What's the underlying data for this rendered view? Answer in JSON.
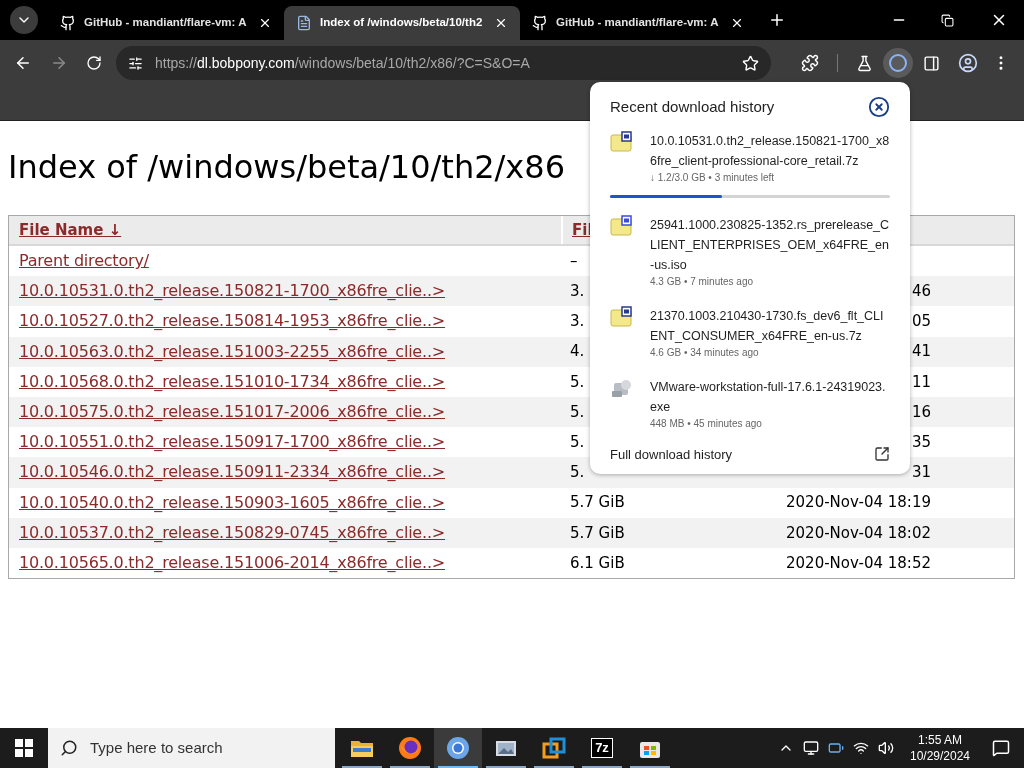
{
  "tabs": [
    {
      "title": "GitHub - mandiant/flare-vm: A",
      "kind": "github",
      "selected": false
    },
    {
      "title": "Index of /windows/beta/10/th2",
      "kind": "page",
      "selected": true
    },
    {
      "title": "GitHub - mandiant/flare-vm: A",
      "kind": "github",
      "selected": false
    }
  ],
  "address": {
    "scheme": "https://",
    "host": "dl.bobpony.com",
    "path": "/windows/beta/10/th2/x86/?C=S&O=A"
  },
  "page": {
    "heading": "Index of /windows/beta/10/th2/x86",
    "columns": [
      "File Name ↓",
      "Fil"
    ],
    "rows": [
      {
        "name": "Parent directory/",
        "size": "–",
        "date": ""
      },
      {
        "name": "10.0.10531.0.th2_release.150821-1700_x86fre_clie..>",
        "size": "3.",
        "date": "46"
      },
      {
        "name": "10.0.10527.0.th2_release.150814-1953_x86fre_clie..>",
        "size": "3.",
        "date": "05"
      },
      {
        "name": "10.0.10563.0.th2_release.151003-2255_x86fre_clie..>",
        "size": "4.",
        "date": "41"
      },
      {
        "name": "10.0.10568.0.th2_release.151010-1734_x86fre_clie..>",
        "size": "5.",
        "date": "11"
      },
      {
        "name": "10.0.10575.0.th2_release.151017-2006_x86fre_clie..>",
        "size": "5.",
        "date": "16"
      },
      {
        "name": "10.0.10551.0.th2_release.150917-1700_x86fre_clie..>",
        "size": "5.",
        "date": "35"
      },
      {
        "name": "10.0.10546.0.th2_release.150911-2334_x86fre_clie..>",
        "size": "5.",
        "date": "31"
      },
      {
        "name": "10.0.10540.0.th2_release.150903-1605_x86fre_clie..>",
        "size": "5.7 GiB",
        "date": "2020-Nov-04 18:19"
      },
      {
        "name": "10.0.10537.0.th2_release.150829-0745_x86fre_clie..>",
        "size": "5.7 GiB",
        "date": "2020-Nov-04 18:02"
      },
      {
        "name": "10.0.10565.0.th2_release.151006-2014_x86fre_clie..>",
        "size": "6.1 GiB",
        "date": "2020-Nov-04 18:52"
      }
    ]
  },
  "downloads": {
    "title": "Recent download history",
    "footer": "Full download history",
    "items": [
      {
        "kind": "archive",
        "name": "10.0.10531.0.th2_release.150821-1700_x86fre_client-professional-core_retail.7z",
        "detail": "↓ 1.2/3.0 GB • 3 minutes left",
        "level": 0.4
      },
      {
        "kind": "disc-image",
        "name": "25941.1000.230825-1352.rs_prerelease_CLIENT_ENTERPRISES_OEM_x64FRE_en-us.iso",
        "detail": "4.3 GB • 7 minutes ago"
      },
      {
        "kind": "archive",
        "name": "21370.1003.210430-1730.fs_dev6_flt_CLIENT_CONSUMER_x64FRE_en-us.7z",
        "detail": "4.6 GB • 34 minutes ago"
      },
      {
        "kind": "installer",
        "name": "VMware-workstation-full-17.6.1-24319023.exe",
        "detail": "448 MB • 45 minutes ago"
      }
    ]
  },
  "taskbar": {
    "search_placeholder": "Type here to search",
    "apps": [
      {
        "kind": "folder",
        "selected": false
      },
      {
        "kind": "firefox",
        "selected": false
      },
      {
        "kind": "chrome",
        "selected": true
      },
      {
        "kind": "viewer",
        "selected": false
      },
      {
        "kind": "vmware",
        "selected": false
      },
      {
        "kind": "sevenzip",
        "label": "7z",
        "selected": false
      },
      {
        "kind": "store",
        "selected": false
      }
    ],
    "time": "1:55 AM",
    "date": "10/29/2024"
  }
}
